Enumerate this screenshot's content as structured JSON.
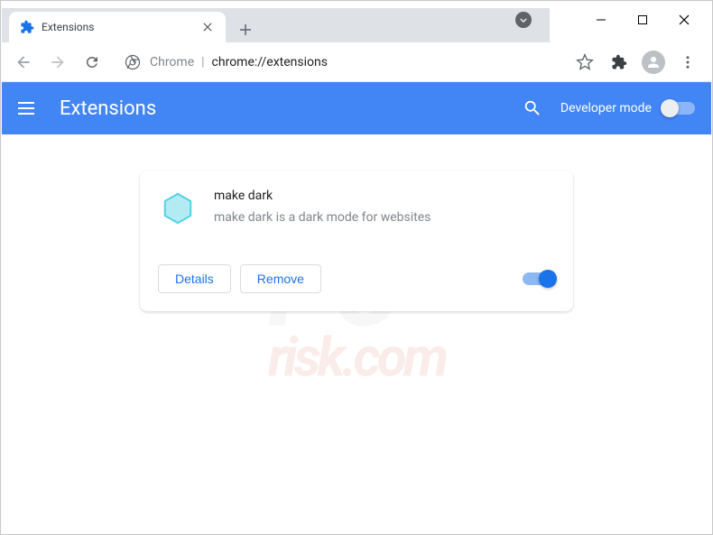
{
  "window": {
    "tab_title": "Extensions",
    "omnibox_prefix": "Chrome",
    "omnibox_path": "chrome://extensions"
  },
  "header": {
    "title": "Extensions",
    "dev_mode_label": "Developer mode",
    "dev_mode_on": false
  },
  "extension": {
    "name": "make dark",
    "description": "make dark is a dark mode for websites",
    "details_label": "Details",
    "remove_label": "Remove",
    "enabled": true
  },
  "icons": {
    "puzzle": "puzzle-icon",
    "chrome": "chrome-icon",
    "star": "star-icon",
    "extensions": "extensions-icon",
    "profile": "profile-icon",
    "menu": "menu-icon"
  },
  "watermark": {
    "line1": "PC",
    "line2": "risk.com"
  }
}
